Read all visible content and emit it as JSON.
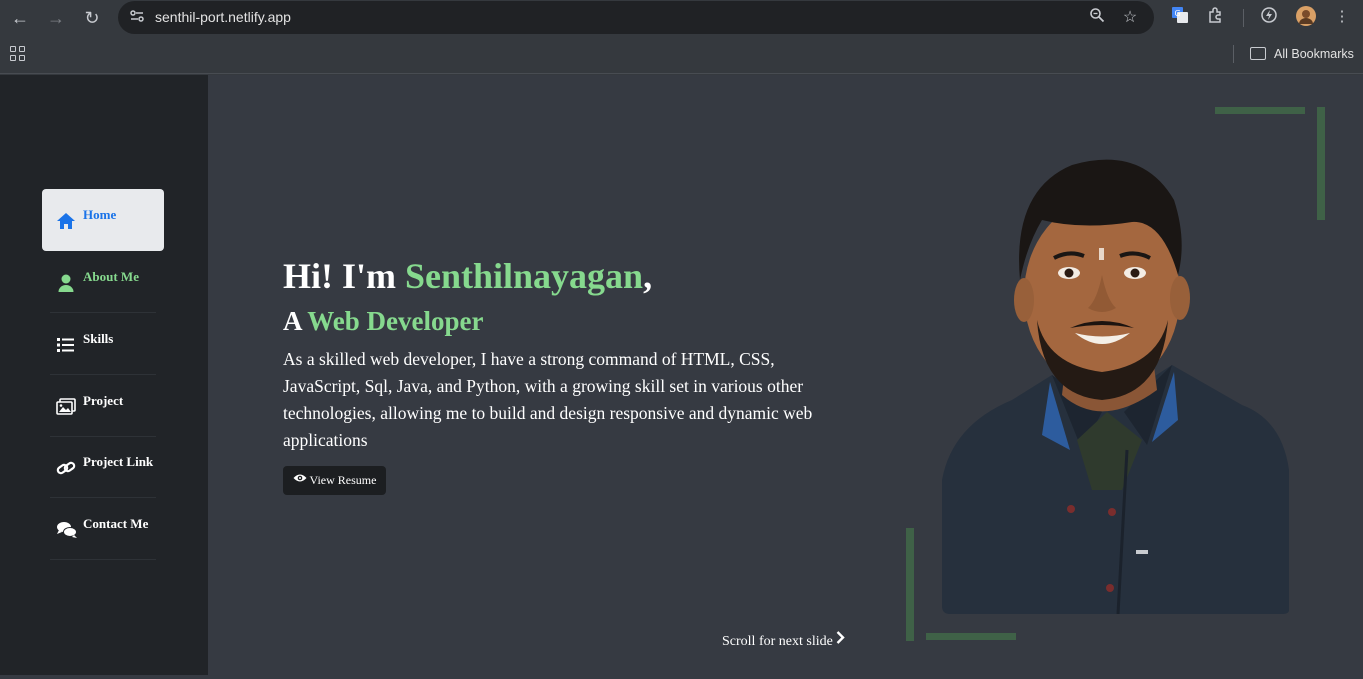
{
  "browser": {
    "url": "senthil-port.netlify.app",
    "bookmarks_label": "All Bookmarks"
  },
  "sidebar": {
    "items": [
      {
        "label": "Home",
        "icon": "home-icon"
      },
      {
        "label": "About Me",
        "icon": "user-icon"
      },
      {
        "label": "Skills",
        "icon": "list-icon"
      },
      {
        "label": "Project",
        "icon": "images-icon"
      },
      {
        "label": "Project Link",
        "icon": "link-icon"
      },
      {
        "label": "Contact Me",
        "icon": "comments-icon"
      }
    ]
  },
  "hero": {
    "greeting_prefix": "Hi! I'm ",
    "name": "Senthilnayagan",
    "greeting_suffix": ",",
    "role_prefix": "A ",
    "role": "Web Developer",
    "description": "As a skilled web developer, I have a strong command of HTML, CSS, JavaScript, Sql, Java, and Python, with a growing skill set in various other technologies, allowing me to build and design responsive and dynamic web applications",
    "resume_button": "View Resume",
    "scroll_hint": "Scroll for next slide"
  },
  "colors": {
    "accent_green": "#86d98e",
    "active_blue": "#1a73e8",
    "sidebar_bg": "#212428",
    "page_bg": "#363a42",
    "deco_green": "#3f6147"
  }
}
